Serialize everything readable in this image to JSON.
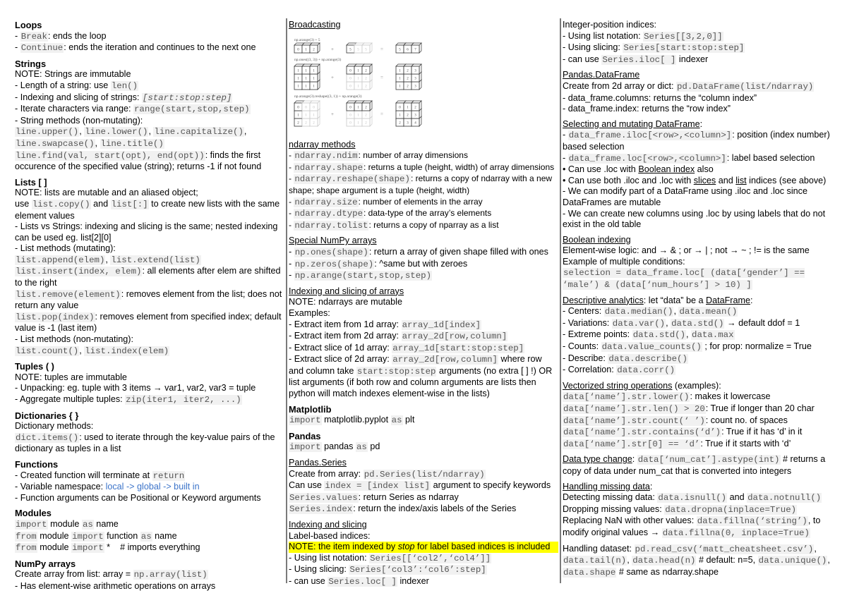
{
  "col1": {
    "loops": {
      "title": "Loops",
      "break_code": "Break",
      "break_text": ": ends the loop",
      "continue_code": "Continue",
      "continue_text": ": ends the iteration and continues to the next one"
    },
    "strings": {
      "title": "Strings",
      "note": "NOTE: Strings are immutable",
      "len_text": "- Length of a string: use ",
      "len_code": "len()",
      "slice_text": "- Indexing and slicing of strings: ",
      "slice_code": "[start:stop:step]",
      "range_text": "- Iterate characters via range: ",
      "range_code": "range(start,stop,step)",
      "methods_text": "- String methods (non-mutating):",
      "m1": "line.upper()",
      "m2": "line.lower()",
      "m3": "line.capitalize()",
      "m4": "line.swapcase()",
      "m5": "line.title()",
      "find_code": "line.find(val, start(opt), end(opt))",
      "find_text": ": finds the first occurence of the specified value (string); returns -1 if not found"
    },
    "lists": {
      "title": "Lists [ ]",
      "note": "NOTE: lists are mutable and an aliased object;",
      "use": "use ",
      "copy_code": "list.copy()",
      "and": " and ",
      "slice_code": "list[:]",
      "copy_text": " to create new lists with the same element values",
      "vs": "- Lists vs Strings: indexing and slicing is the same; nested indexing can be used eg. list[2][0]",
      "mut_title": "- List methods (mutating):",
      "append": "list.append(elem)",
      "extend": "list.extend(list)",
      "insert": "list.insert(index, elem)",
      "insert_text": ": all elements after elem are shifted to the right",
      "remove": "list.remove(element)",
      "remove_text": ": removes element from the list; does not return any value",
      "pop": "list.pop(index)",
      "pop_text": ": removes element from specified index; default value is -1 (last item)",
      "nonmut_title": "- List methods (non-mutating):",
      "count": "list.count()",
      "index": "list.index(elem)"
    },
    "tuples": {
      "title": "Tuples ( )",
      "note": "NOTE: tuples are immutable",
      "unpack": "- Unpacking: eg. tuple with 3 items → var1, var2, var3 = tuple",
      "zip_text": "- Aggregate multiple tuples: ",
      "zip_code": "zip(iter1, iter2, ...)"
    },
    "dicts": {
      "title": "Dictionaries { }",
      "methods": "Dictionary methods:",
      "items_code": "dict.items()",
      "items_text": ": used to iterate through the key-value pairs of the dictionary as tuples in a list"
    },
    "functions": {
      "title": "Functions",
      "ret_text": "- Created function will terminate at ",
      "ret_code": "return",
      "ns_text": "- Variable namespace: ",
      "ns_value": "local -> global -> built in",
      "args": "- Function arguments can be Positional or Keyword arguments"
    },
    "modules": {
      "title": "Modules",
      "import": "import",
      "from": "from",
      "as": "as",
      "module": " module ",
      "name": " name",
      "function": " function ",
      "star": " *",
      "comment": "    # imports everything"
    },
    "numpy": {
      "title": "NumPy arrays",
      "create_text": "Create array from list: array = ",
      "create_code": "np.array(list)",
      "elementwise": "- Has element-wise arithmetic operations on arrays"
    }
  },
  "col2": {
    "broadcasting": {
      "title": "Broadcasting",
      "fig_labels": [
        "np.arange(3) + 5",
        "np.ones((3, 3)) + np.arange(3)",
        "np.arange(3).reshape((3, 1)) + np.arange(3)"
      ]
    },
    "ndarray": {
      "title": "ndarray methods",
      "items": [
        {
          "code": "ndarray.ndim",
          "text": ": number of array dimensions"
        },
        {
          "code": "ndarray.shape",
          "text": ": returns a tuple (height, width) of array dimensions"
        },
        {
          "code": "ndarray.reshape(shape)",
          "text": ": returns a copy of ndarray with a new shape; shape argument is a tuple (height, width)"
        },
        {
          "code": "ndarray.size",
          "text": ": number of elements in the array"
        },
        {
          "code": "ndarray.dtype",
          "text": ": data-type of the array’s elements"
        },
        {
          "code": "ndarray.tolist",
          "text": ": returns a copy of nparray as a list"
        }
      ]
    },
    "special": {
      "title": "Special NumPy arrays",
      "ones": "np.ones(shape)",
      "ones_text": ": return a array of given shape filled with ones",
      "zeros": "np.zeros(shape)",
      "zeros_text": ": ^same but with zeroes",
      "arange": "np.arange(start,stop,step)"
    },
    "idx": {
      "title": "Indexing and slicing of arrays",
      "note": "NOTE: ndarrays are mutable",
      "examples": "Examples:",
      "e1_text": "- Extract item from 1d array: ",
      "e1_code": "array_1d[index]",
      "e2_text": "- Extract item from 2d array: ",
      "e2_code": "array_2d[row,column]",
      "e3_text": "- Extract slice of 1d array: ",
      "e3_code": "array_1d[start:stop:step]",
      "e4_text": "- Extract slice of 2d array: ",
      "e4_code": "array_2d[row,column]",
      "e4_after": " where row and column take ",
      "e4_code2": "start:stop:step",
      "e4_end": " arguments (no extra [ ] !) OR list arguments (if both row and column arguments are lists then python will match indexes element-wise in the lists)"
    },
    "mpl": {
      "title": "Matplotlib",
      "import": "import",
      "mod": " matplotlib.pyplot ",
      "as": "as",
      "alias": " plt"
    },
    "pandas": {
      "title": "Pandas",
      "import": "import",
      "mod": " pandas ",
      "as": "as",
      "alias": " pd"
    },
    "series": {
      "title": "Pandas.Series",
      "create_text": "Create from array: ",
      "create_code": "pd.Series(list/ndarray)",
      "index_text": "Can use ",
      "index_code": "index = [index list]",
      "index_after": " argument to specify keywords",
      "values_code": "Series.values",
      "values_text": ": return Series as ndarray",
      "sindex_code": "Series.index",
      "sindex_text": ": return the index/axis labels of the Series"
    },
    "slicing": {
      "title": "Indexing and slicing",
      "label": "Label-based indices:",
      "note_a": "NOTE: the item indexed by ",
      "note_em": "stop",
      "note_b": " for label based indices is included",
      "list_text": "- Using list notation: ",
      "list_code": "Series[[‘col2’,‘col4’]]",
      "slice_text": "- Using slicing: ",
      "slice_code": "Series[‘col3’:‘col6’:step]",
      "loc_text": "- can use ",
      "loc_code": "Series.loc[ ]",
      "loc_after": " indexer"
    }
  },
  "col3": {
    "intpos": {
      "title": "Integer-position indices:",
      "list_text": "- Using list notation: ",
      "list_code": "Series[[3,2,0]]",
      "slice_text": "- Using slicing: ",
      "slice_code": "Series[start:stop:step]",
      "iloc_text": "- can use ",
      "iloc_code": "Series.iloc[ ]",
      "iloc_after": " indexer"
    },
    "dataframe": {
      "title": "Pandas.DataFrame",
      "create_text": "Create from 2d array or dict: ",
      "create_code": "pd.DataFrame(list/ndarray)",
      "columns": "- data_frame.columns: returns the “column index”",
      "index": "- data_frame.index: returns the “row index”"
    },
    "selecting": {
      "title": "Selecting and mutating DataFrame",
      "colon": ":",
      "iloc_code": "data_frame.iloc[<row>,<column>]",
      "iloc_text": ": position (index number) based selection",
      "loc_code": "data_frame.loc[<row>,<column>]",
      "loc_text": ": label based selection",
      "b1_a": "• Can use .loc with ",
      "b1_u": "Boolean index",
      "b1_b": " also",
      "b2_a": "• Can use both .iloc and .loc with ",
      "b2_u1": "slices",
      "b2_m": " and ",
      "b2_u2": "list",
      "b2_b": " indices (see above)",
      "modify": "- We can modify part of a DataFrame using .iloc and .loc since DataFrames are mutable",
      "create": "- We can create new columns using .loc by using labels that do not exist in the old table"
    },
    "boolean": {
      "title": "Boolean indexing",
      "logic": "Element-wise logic: and → & ; or → | ; not → ~ ; != is the same",
      "example": "Example of multiple conditions:",
      "code": "selection = data_frame.loc[ (data[‘gender’] == ‘male’) & (data[‘num_hours’] > 10) ]"
    },
    "descriptive": {
      "title": "Descriptive analytics",
      "intro": ": let “data” be a ",
      "df": "DataFrame",
      "colon": ":",
      "centers_text": "- Centers: ",
      "median": "data.median()",
      "mean": "data.mean()",
      "var_text": "- Variations: ",
      "var": "data.var()",
      "std": "data.std()",
      "var_after": " → default ddof = 1",
      "ext_text": "- Extreme points: ",
      "ext1": "data.std()",
      "ext2": "data.max",
      "counts_text": "- Counts: ",
      "counts_code": "data.value_counts()",
      "counts_after": " ; for prop: normalize = True",
      "describe_text": "- Describe: ",
      "describe_code": "data.describe()",
      "corr_text": "- Correlation: ",
      "corr_code": "data.corr()"
    },
    "vectorized": {
      "title": "Vectorized string operations",
      "suffix": " (examples):",
      "items": [
        {
          "code": "data[‘name’].str.lower()",
          "text": ": makes it lowercase"
        },
        {
          "code": "data[‘name’].str.len() > 20",
          "text": ": True if longer than 20 char"
        },
        {
          "code": "data[‘name’].str.count(‘ ’)",
          "text": ": count no. of spaces"
        },
        {
          "code": "data[‘name’].str.contains(‘d’)",
          "text": ": True if it has ‘d’ in it"
        },
        {
          "code": "data[‘name’].str[0] == ‘d’",
          "text": ": True if it starts with ‘d’"
        }
      ]
    },
    "dtype": {
      "title": "Data type change",
      "colon": ": ",
      "code": "data[‘num_cat’].astype(int)",
      "text": " # returns a copy of data under num_cat that is converted into integers"
    },
    "missing": {
      "title": "Handling missing data",
      "colon": ":",
      "detect_text": "Detecting missing data: ",
      "isnull": "data.isnull()",
      "and": " and ",
      "notnull": "data.notnull()",
      "drop_text": "Dropping missing values: ",
      "drop_code": "data.dropna(inplace=True)",
      "replace_text": "Replacing NaN with other values: ",
      "replace_code": "data.fillna(‘string’)",
      "replace_after": ", to modify original values → ",
      "replace_code2": "data.fillna(0, inplace=True)"
    },
    "dataset": {
      "text": "Handling dataset: ",
      "read": "pd.read_csv(‘matt_cheatsheet.csv’)",
      "tail": "data.tail(n)",
      "head": "data.head(n)",
      "default": " # default: n=5,",
      "unique": "data.unique()",
      "shape": "data.shape",
      "shape_after": " # same as ndarray.shape"
    }
  }
}
